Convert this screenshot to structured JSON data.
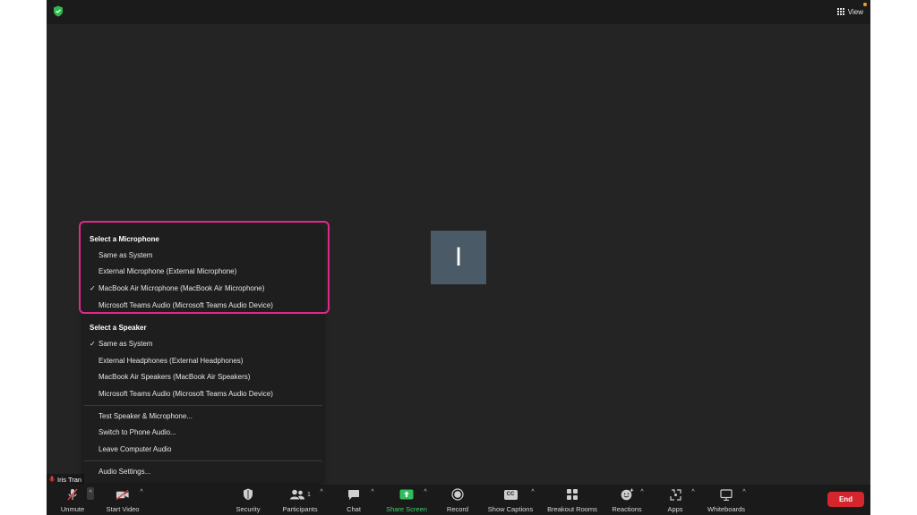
{
  "topbar": {
    "view_label": "View"
  },
  "avatar": {
    "initial": "I"
  },
  "name_tag": {
    "name": "Iris Tran"
  },
  "audio_menu": {
    "microphone_header": "Select a Microphone",
    "microphones": [
      {
        "label": "Same as System",
        "checked": false
      },
      {
        "label": "External Microphone (External Microphone)",
        "checked": false
      },
      {
        "label": "MacBook Air Microphone (MacBook Air Microphone)",
        "checked": true
      },
      {
        "label": "Microsoft Teams Audio (Microsoft Teams Audio Device)",
        "checked": false
      }
    ],
    "speaker_header": "Select a Speaker",
    "speakers": [
      {
        "label": "Same as System",
        "checked": true
      },
      {
        "label": "External Headphones (External Headphones)",
        "checked": false
      },
      {
        "label": "MacBook Air Speakers (MacBook Air Speakers)",
        "checked": false
      },
      {
        "label": "Microsoft Teams Audio (Microsoft Teams Audio Device)",
        "checked": false
      }
    ],
    "actions": [
      "Test Speaker & Microphone...",
      "Switch to Phone Audio...",
      "Leave Computer Audio"
    ],
    "settings": "Audio Settings...",
    "check_glyph": "✓"
  },
  "toolbar": {
    "unmute": "Unmute",
    "start_video": "Start Video",
    "security": "Security",
    "participants": "Participants",
    "participants_count": "1",
    "chat": "Chat",
    "share_screen": "Share Screen",
    "record": "Record",
    "show_captions": "Show Captions",
    "captions_icon_text": "CC",
    "breakout_rooms": "Breakout Rooms",
    "reactions": "Reactions",
    "apps": "Apps",
    "whiteboards": "Whiteboards",
    "end": "End",
    "caret_glyph": "^"
  },
  "colors": {
    "highlight": "#e0288c",
    "share_green": "#3ccf6a",
    "end_red": "#d6262d",
    "shield_green": "#2db84a",
    "mute_red": "#e03c3c"
  }
}
